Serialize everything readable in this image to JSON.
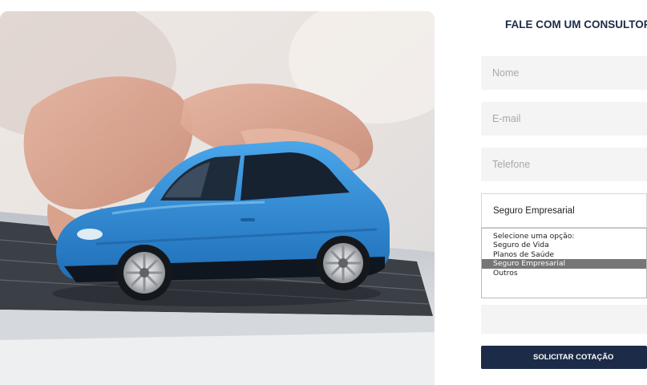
{
  "hero": {
    "image_subject": "blue-toy-car-on-laptop-keyboard-with-typing-hands"
  },
  "form": {
    "title": "FALE COM UM CONSULTOR",
    "name_placeholder": "Nome",
    "email_placeholder": "E-mail",
    "phone_placeholder": "Telefone",
    "select_value": "Seguro Empresarial",
    "options": [
      "Selecione uma opção:",
      "Seguro de Vida",
      "Planos de Saúde",
      "Seguro Empresarial",
      "Outros"
    ],
    "selected_option": "Seguro Empresarial",
    "submit_label": "SOLICITAR COTAÇÃO"
  },
  "colors": {
    "brand_navy": "#1c2b48",
    "field_background": "#f4f4f4",
    "selected_option_background": "#767676",
    "car_blue": "#2f8fd6"
  }
}
